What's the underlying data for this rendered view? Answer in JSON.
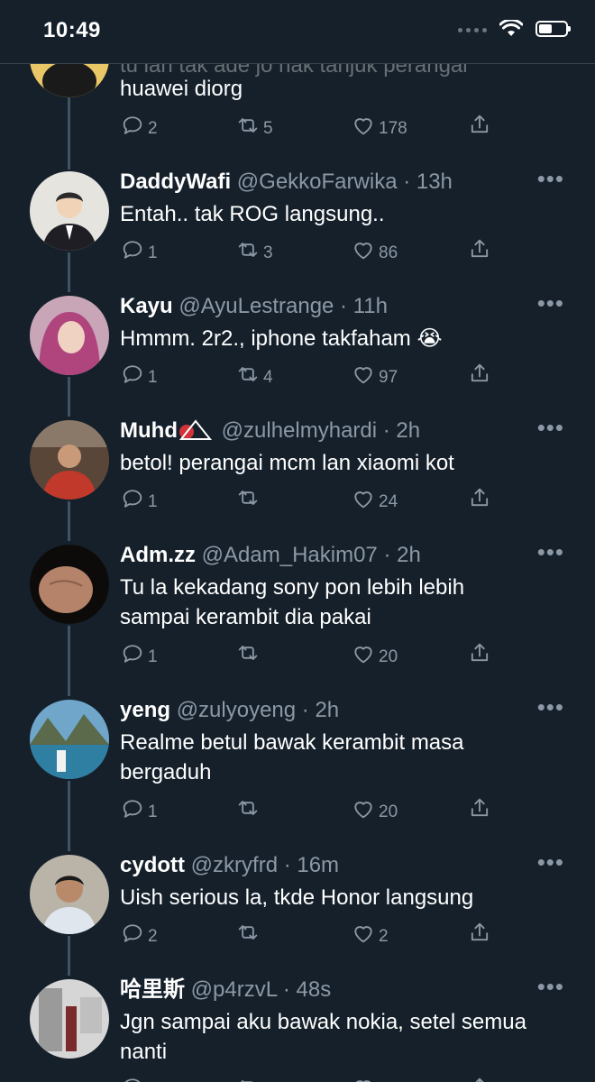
{
  "status_bar": {
    "time": "10:49"
  },
  "partial_top": {
    "text_line1": "tu lah tak ade jo nak tanjuk perangai",
    "text_line2": "huawei diorg",
    "replies": "2",
    "retweets": "5",
    "likes": "178"
  },
  "tweets": [
    {
      "name": "DaddyWafi",
      "handle": "@GekkoFarwika · 13h",
      "text": "Entah.. tak ROG langsung..",
      "replies": "1",
      "retweets": "3",
      "likes": "86"
    },
    {
      "name": "Kayu",
      "handle": "@AyuLestrange · 11h",
      "text": "Hmmm. 2r2., iphone takfaham 😭",
      "replies": "1",
      "retweets": "4",
      "likes": "97"
    },
    {
      "name": "Muhd",
      "handle": "@zulhelmyhardi · 2h",
      "text": "betol! perangai mcm lan xiaomi kot",
      "replies": "1",
      "retweets": "",
      "likes": "24"
    },
    {
      "name": "Adm.zz",
      "handle": "@Adam_Hakim07 · 2h",
      "text": "Tu la kekadang sony pon lebih lebih sampai kerambit dia pakai",
      "replies": "1",
      "retweets": "",
      "likes": "20"
    },
    {
      "name": "yeng",
      "handle": "@zulyoyeng · 2h",
      "text": "Realme betul bawak kerambit masa bergaduh",
      "replies": "1",
      "retweets": "",
      "likes": "20"
    },
    {
      "name": "cydott",
      "handle": "@zkryfrd · 16m",
      "text": "Uish serious la, tkde Honor langsung",
      "replies": "2",
      "retweets": "",
      "likes": "2"
    },
    {
      "name": "哈里斯",
      "handle": "@p4rzvL · 48s",
      "text": "Jgn sampai aku bawak nokia, setel semua nanti",
      "replies": "",
      "retweets": "",
      "likes": ""
    }
  ],
  "icons": [
    "reply-icon",
    "retweet-icon",
    "like-icon",
    "share-icon",
    "more-icon",
    "wifi-icon",
    "battery-icon"
  ],
  "colors": {
    "background": "#15202b",
    "secondary_text": "#8b98a5",
    "thread_line": "#3d5466"
  }
}
